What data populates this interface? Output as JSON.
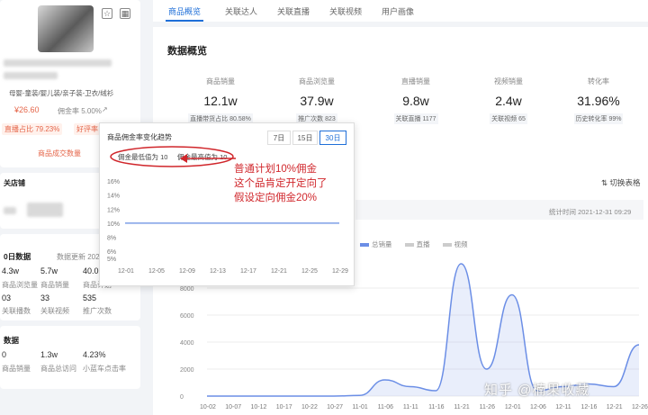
{
  "left": {
    "category": "母婴-童装/婴儿装/亲子装-卫衣/绒衫",
    "price": "¥26.60",
    "commission": "佣金率 5.00%",
    "live_sale_badge": "直播占比 79.23%",
    "good_rate_badge": "好评率",
    "trend_link": "商品成交数量",
    "shop_label": "关店铺",
    "data_section": "0日数据",
    "data_update": "数据更新 2021-",
    "stats_row1_values": [
      "4.3w",
      "5.7w",
      "40.0"
    ],
    "stats_row1_labels": [
      "商品浏览量",
      "商品销量",
      "商品计划"
    ],
    "stats_row2_values": [
      "03",
      "33",
      "535"
    ],
    "stats_row2_labels": [
      "关联播数",
      "关联视频",
      "推广次数"
    ],
    "bottom_section": "数据",
    "bottom_values": [
      "0",
      "1.3w",
      "4.23%"
    ],
    "bottom_labels": [
      "商品销量",
      "商品总访问",
      "小蓝车点击率"
    ]
  },
  "tabs": [
    "商品概览",
    "关联达人",
    "关联直播",
    "关联视频",
    "用户画像"
  ],
  "main": {
    "title": "数据概览",
    "metrics": [
      {
        "label": "商品销量",
        "value": "12.1w",
        "sub": "直播带货占比 80.58%"
      },
      {
        "label": "商品浏览量",
        "value": "37.9w",
        "sub": "推广次数 823"
      },
      {
        "label": "直播销量",
        "value": "9.8w",
        "sub": "关联直播 1177"
      },
      {
        "label": "视频销量",
        "value": "2.4w",
        "sub": "关联视频 65"
      },
      {
        "label": "转化率",
        "value": "31.96%",
        "sub": "历史转化率 99%"
      }
    ],
    "toggle_table": "切换表格",
    "stat_time": "统计时间 2021-12-31 09:29",
    "legend": [
      "总销量",
      "直播",
      "视频"
    ]
  },
  "popup": {
    "title": "商品佣金率变化趋势",
    "ranges": [
      "7日",
      "15日",
      "30日"
    ],
    "min_label": "佣金最低值为 10",
    "max_label": "佣金最高值为 10",
    "note_lines": [
      "普通计划10%佣金",
      "这个品肯定开定向了",
      "假设定向佣金20%"
    ]
  },
  "watermark": "知乎 @楠果收藏",
  "chart_data": [
    {
      "type": "line",
      "title": "商品佣金率变化趋势",
      "x": [
        "12-01",
        "12-05",
        "12-09",
        "12-13",
        "12-17",
        "12-21",
        "12-25",
        "12-29"
      ],
      "series": [
        {
          "name": "佣金率",
          "values": [
            10,
            10,
            10,
            10,
            10,
            10,
            10,
            10
          ]
        }
      ],
      "yticks": [
        "16%",
        "14%",
        "12%",
        "10%",
        "8%",
        "6%",
        "5%"
      ],
      "ylim": [
        5,
        16
      ]
    },
    {
      "type": "line",
      "x": [
        "10-02",
        "10-07",
        "10-12",
        "10-17",
        "10-22",
        "10-27",
        "11-01",
        "11-06",
        "11-11",
        "11-16",
        "11-21",
        "11-26",
        "12-01",
        "12-06",
        "12-11",
        "12-16",
        "12-21",
        "12-26"
      ],
      "yticks": [
        "0",
        "2000",
        "4000",
        "6000",
        "8000"
      ],
      "ylim": [
        0,
        10000
      ],
      "series": [
        {
          "name": "总销量",
          "values": [
            0,
            0,
            0,
            0,
            0,
            0,
            50,
            1200,
            700,
            400,
            9800,
            2000,
            7500,
            400,
            700,
            900,
            700,
            3800
          ]
        }
      ]
    }
  ]
}
